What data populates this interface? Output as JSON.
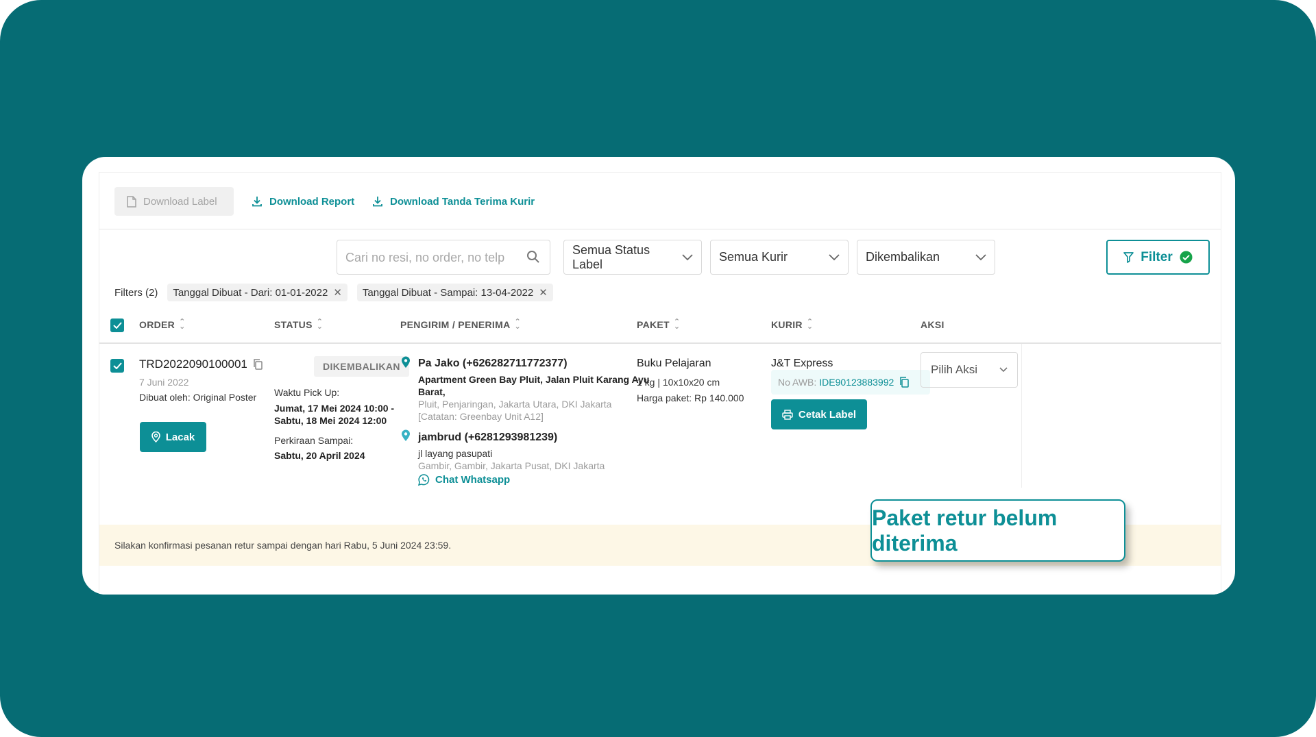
{
  "toolbar": {
    "download_label": "Download Label",
    "download_report": "Download Report",
    "download_tanda_terima": "Download Tanda Terima Kurir"
  },
  "filters_bar": {
    "search_placeholder": "Cari no resi, no order, no telp",
    "status_label_select": "Semua Status Label",
    "kurir_select": "Semua Kurir",
    "status_select": "Dikembalikan",
    "filter_button": "Filter"
  },
  "active_filters": {
    "label": "Filters (2)",
    "chips": [
      "Tanggal Dibuat - Dari: 01-01-2022",
      "Tanggal Dibuat - Sampai: 13-04-2022"
    ]
  },
  "table": {
    "headers": {
      "order": "ORDER",
      "status": "STATUS",
      "pengirim": "PENGIRIM / PENERIMA",
      "paket": "PAKET",
      "kurir": "KURIR",
      "aksi": "AKSI"
    },
    "row": {
      "order_id": "TRD2022090100001",
      "order_date": "7 Juni 2022",
      "created_by": "Dibuat oleh: Original Poster",
      "lacak_button": "Lacak",
      "status_badge": "DIKEMBALIKAN",
      "pickup_label": "Waktu Pick Up:",
      "pickup_value_1": "Jumat, 17 Mei 2024 10:00 -",
      "pickup_value_2": "Sabtu, 18 Mei 2024 12:00",
      "eta_label": "Perkiraan Sampai:",
      "eta_value": "Sabtu, 20 April 2024",
      "sender_name": "Pa Jako (+626282711772377)",
      "sender_address_1": "Apartment Green Bay Pluit, Jalan Pluit Karang Ayu",
      "sender_address_2": "Barat,",
      "sender_region": "Pluit, Penjaringan, Jakarta Utara, DKI Jakarta",
      "sender_note": "[Catatan: Greenbay Unit A12]",
      "receiver_name": "jambrud (+6281293981239)",
      "receiver_address": "jl layang pasupati",
      "receiver_region": "Gambir, Gambir, Jakarta Pusat, DKI Jakarta",
      "chat_whatsapp": "Chat Whatsapp",
      "package_name": "Buku Pelajaran",
      "package_spec": "1 kg | 10x10x20 cm",
      "package_price": "Harga paket: Rp 140.000",
      "courier": "J&T Express",
      "awb_label": "No AWB:",
      "awb_value": "IDE90123883992",
      "cetak_label_button": "Cetak Label",
      "aksi_select": "Pilih Aksi"
    }
  },
  "notice": "Silakan konfirmasi pesanan retur sampai dengan hari Rabu, 5 Juni 2024 23:59.",
  "callout": "Paket retur belum diterima",
  "colors": {
    "background": "#066c74",
    "accent": "#0d8f96",
    "notice_bg": "#fdf7e6",
    "whatsapp_green": "#0d8f96"
  },
  "icons": [
    "file-icon",
    "download-icon",
    "search-icon",
    "chevron-down-icon",
    "filter-icon",
    "check-circle-icon",
    "close-icon",
    "sort-icon",
    "checkbox-icon",
    "copy-icon",
    "location-pin-icon",
    "whatsapp-icon",
    "printer-icon"
  ]
}
